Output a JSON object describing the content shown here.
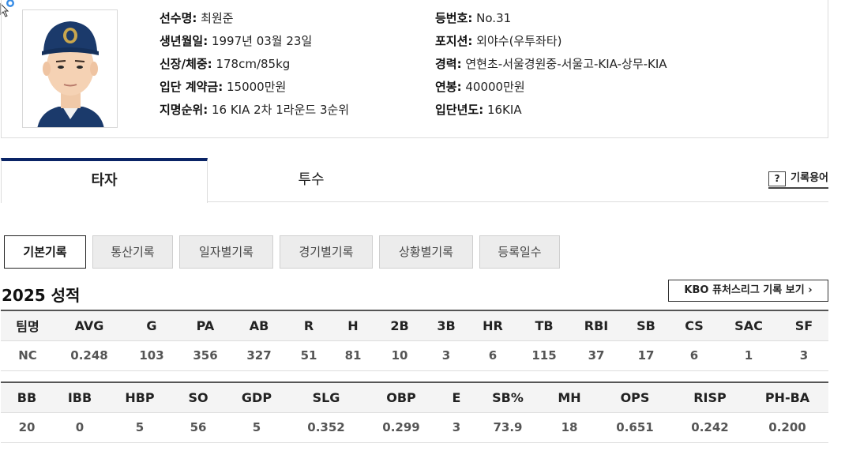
{
  "profile": {
    "left": [
      {
        "label": "선수명:",
        "value": " 최원준"
      },
      {
        "label": "생년월일:",
        "value": " 1997년 03월 23일"
      },
      {
        "label": "신장/체중:",
        "value": " 178cm/85kg"
      },
      {
        "label": "입단 계약금:",
        "value": " 15000만원"
      },
      {
        "label": "지명순위:",
        "value": " 16 KIA 2차 1라운드 3순위"
      }
    ],
    "right": [
      {
        "label": "등번호:",
        "value": " No.31"
      },
      {
        "label": "포지션:",
        "value": " 외야수(우투좌타)"
      },
      {
        "label": "경력:",
        "value": " 연현초-서울경원중-서울고-KIA-상무-KIA"
      },
      {
        "label": "연봉:",
        "value": " 40000만원"
      },
      {
        "label": "입단년도:",
        "value": " 16KIA"
      }
    ]
  },
  "tabs": {
    "hitter": "타자",
    "pitcher": "투수",
    "glossary": "기록용어",
    "glossary_icon": "?"
  },
  "subtabs": [
    "기본기록",
    "통산기록",
    "일자별기록",
    "경기별기록",
    "상황별기록",
    "등록일수"
  ],
  "season_title": "2025 성적",
  "futures_button": "KBO 퓨처스리그 기록 보기 ›",
  "table1": {
    "headers": [
      "팀명",
      "AVG",
      "G",
      "PA",
      "AB",
      "R",
      "H",
      "2B",
      "3B",
      "HR",
      "TB",
      "RBI",
      "SB",
      "CS",
      "SAC",
      "SF"
    ],
    "row": [
      "NC",
      "0.248",
      "103",
      "356",
      "327",
      "51",
      "81",
      "10",
      "3",
      "6",
      "115",
      "37",
      "17",
      "6",
      "1",
      "3"
    ]
  },
  "table2": {
    "headers": [
      "BB",
      "IBB",
      "HBP",
      "SO",
      "GDP",
      "SLG",
      "OBP",
      "E",
      "SB%",
      "MH",
      "OPS",
      "RISP",
      "PH-BA"
    ],
    "row": [
      "20",
      "0",
      "5",
      "56",
      "5",
      "0.352",
      "0.299",
      "3",
      "73.9",
      "18",
      "0.651",
      "0.242",
      "0.200"
    ]
  },
  "colors": {
    "accent": "#0a2466",
    "cap": "#1b3a6b"
  }
}
